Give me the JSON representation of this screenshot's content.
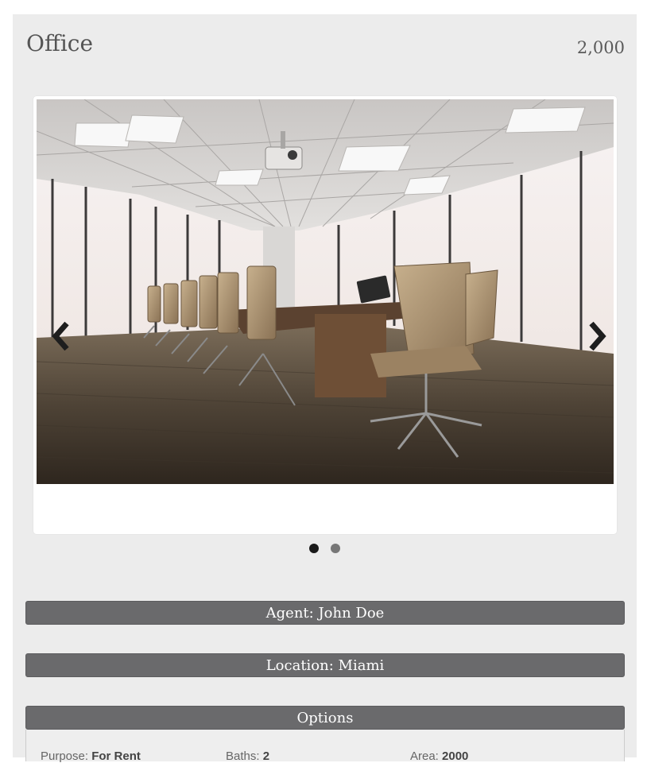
{
  "listing": {
    "title": "Office",
    "price": "2,000"
  },
  "slider": {
    "image_alt": "Conference room with long table, office chairs and floor-to-ceiling windows",
    "prev_icon": "chevron-left-icon",
    "next_icon": "chevron-right-icon",
    "slide_count": 2,
    "active_slide": 1,
    "dot_active_color": "#1a1a1a",
    "dot_inactive_color": "#777777"
  },
  "sections": {
    "agent": "Agent: John Doe",
    "location": "Location: Miami",
    "options": "Options"
  },
  "options": {
    "purpose_label": "Purpose:",
    "purpose_value": "For Rent",
    "baths_label": "Baths:",
    "baths_value": "2",
    "area_label": "Area:",
    "area_value": "2000"
  },
  "colors": {
    "card_bg": "#ececec",
    "bar_bg": "#6a6a6c"
  }
}
